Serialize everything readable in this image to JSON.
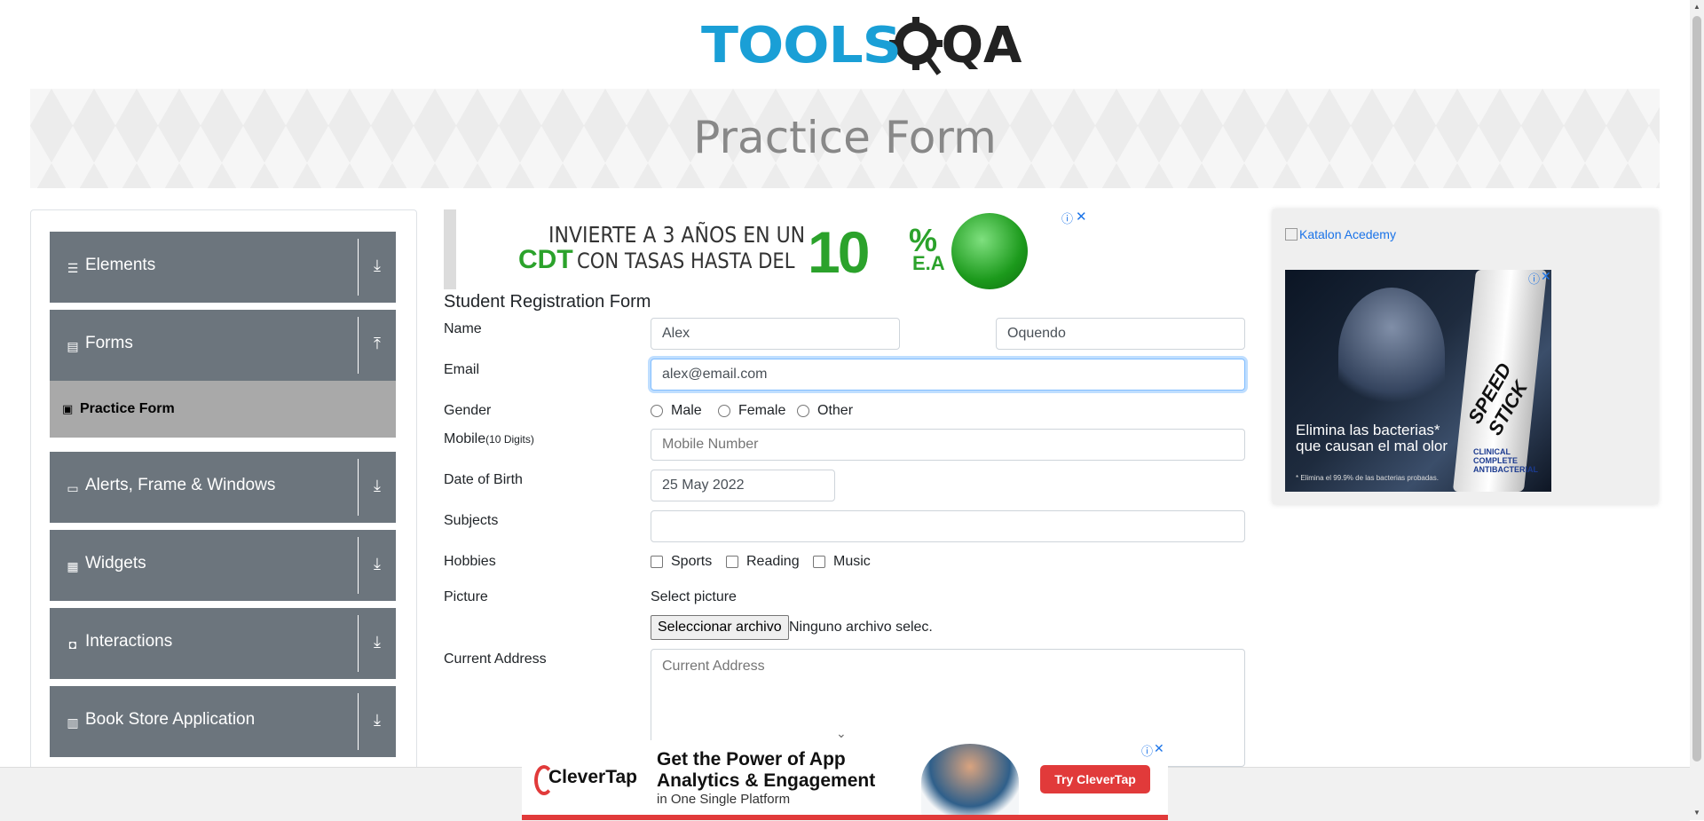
{
  "header": {
    "logo_text_1": "TOOLS",
    "logo_text_2": "QA",
    "page_title": "Practice Form"
  },
  "sidebar": {
    "groups": [
      {
        "label": "Elements",
        "icon": "list-icon",
        "arrow": "download-icon"
      },
      {
        "label": "Forms",
        "icon": "document-icon",
        "arrow": "upload-icon"
      },
      {
        "label": "Alerts, Frame & Windows",
        "icon": "window-icon",
        "arrow": "download-icon"
      },
      {
        "label": "Widgets",
        "icon": "grid-icon",
        "arrow": "download-icon"
      },
      {
        "label": "Interactions",
        "icon": "interactions-icon",
        "arrow": "download-icon"
      },
      {
        "label": "Book Store Application",
        "icon": "books-icon",
        "arrow": "download-icon"
      }
    ],
    "active_item": {
      "label": "Practice Form",
      "icon": "form-icon"
    }
  },
  "top_ad": {
    "line1": "INVIERTE A 3 AÑOS EN UN",
    "cdt": "CDT",
    "line2": "CON TASAS HASTA DEL",
    "big": "10",
    "pct": "%",
    "ea": "E.A"
  },
  "form": {
    "title": "Student Registration Form",
    "name_label": "Name",
    "first_name": "Alex",
    "last_name": "Oquendo",
    "email_label": "Email",
    "email": "alex@email.com",
    "gender_label": "Gender",
    "genders": [
      "Male",
      "Female",
      "Other"
    ],
    "mobile_label": "Mobile",
    "mobile_hint": "(10 Digits)",
    "mobile_placeholder": "Mobile Number",
    "dob_label": "Date of Birth",
    "dob": "25 May 2022",
    "subjects_label": "Subjects",
    "hobbies_label": "Hobbies",
    "hobbies": [
      "Sports",
      "Reading",
      "Music"
    ],
    "picture_label": "Picture",
    "select_picture": "Select picture",
    "file_button": "Seleccionar archivo",
    "file_status": "Ninguno archivo selec.",
    "address_label": "Current Address",
    "address_placeholder": "Current Address"
  },
  "right_ad": {
    "alt_text": "Katalon Acedemy",
    "tagline_1": "Elimina las bacterias*",
    "tagline_2": "que causan el mal olor",
    "brand": "SPEED STICK",
    "product": "CLINICAL COMPLETE ANTIBACTERIAL",
    "footnote": "* Elimina el 99.9% de las bacterias probadas."
  },
  "bottom_ad": {
    "brand": "CleverTap",
    "headline": "Get the Power of App Analytics & Engagement",
    "sub": "in One Single Platform",
    "cta": "Try CleverTap"
  },
  "colors": {
    "logo_blue": "#1a9fd6",
    "sidebar_gray": "#6c757d",
    "active_gray": "#a9a9a9",
    "ad_green": "#2ba22b",
    "clevertap_red": "#e13a3a"
  }
}
